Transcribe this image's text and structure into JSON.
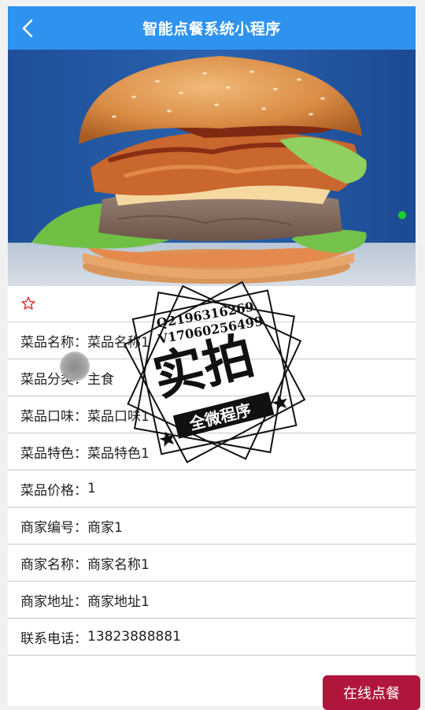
{
  "header": {
    "title": "智能点餐系统小程序"
  },
  "carousel": {
    "active_dot_color": "#19d22b"
  },
  "detail": {
    "fields": [
      {
        "label": "菜品名称：",
        "value": "菜品名称1"
      },
      {
        "label": "菜品分类：",
        "value": "主食"
      },
      {
        "label": "菜品口味：",
        "value": "菜品口味1"
      },
      {
        "label": "菜品特色：",
        "value": "菜品特色1"
      },
      {
        "label": "菜品价格：",
        "value": "1"
      },
      {
        "label": "商家编号：",
        "value": "商家1"
      },
      {
        "label": "商家名称：",
        "value": "商家名称1"
      },
      {
        "label": "商家地址：",
        "value": "商家地址1"
      },
      {
        "label": "联系电话：",
        "value": "13823888881"
      }
    ]
  },
  "actions": {
    "order_label": "在线点餐",
    "order_color": "#b0163c"
  },
  "watermark": {
    "line1": "Q2196316269",
    "line2": "V17060256499",
    "main": "实拍",
    "ribbon": "全微程序"
  },
  "colors": {
    "header_bg": "#2e93ef",
    "star": "#e0383b"
  }
}
